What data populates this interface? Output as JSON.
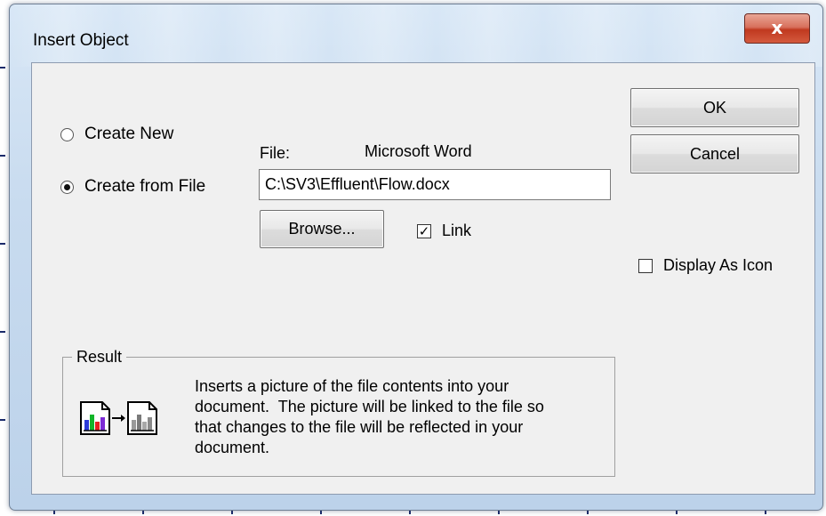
{
  "dialog": {
    "title": "Insert Object",
    "close_glyph": "x"
  },
  "options": {
    "create_new_label": "Create New",
    "create_from_file_label": "Create from File",
    "selected": "create_from_file"
  },
  "file": {
    "label": "File:",
    "type": "Microsoft Word",
    "path": "C:\\SV3\\Effluent\\Flow.docx"
  },
  "buttons": {
    "browse": "Browse...",
    "ok": "OK",
    "cancel": "Cancel"
  },
  "link": {
    "label": "Link",
    "checked": true,
    "check_glyph": "✓"
  },
  "display_as_icon": {
    "label": "Display As Icon",
    "checked": false
  },
  "result": {
    "title": "Result",
    "line1": "Inserts a picture of the file contents into your",
    "line2": "document.  The picture will be linked to the file so",
    "line3": "that changes to the file will be reflected in your",
    "line4": "document.",
    "icon": "linked-picture-icon"
  },
  "colors": {
    "close_red": "#c0391f",
    "dialog_bg": "#f0f0f0"
  }
}
